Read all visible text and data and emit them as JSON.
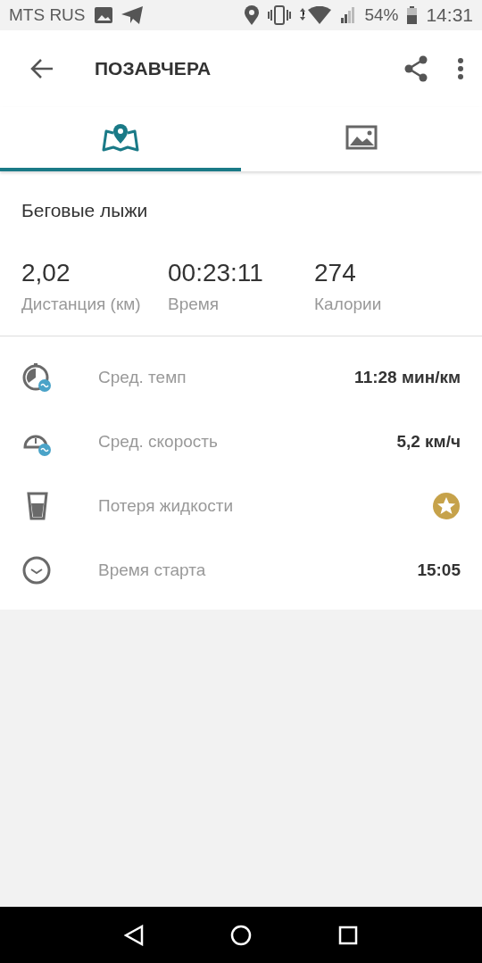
{
  "status_bar": {
    "carrier": "MTS RUS",
    "battery": "54%",
    "time": "14:31"
  },
  "app_bar": {
    "title": "ПОЗАВЧЕРА"
  },
  "tabs": [
    {
      "kind": "map",
      "selected": true
    },
    {
      "kind": "photos",
      "selected": false
    }
  ],
  "activity": "Беговые лыжи",
  "stats": [
    {
      "value": "2,02",
      "label": "Дистанция (км)"
    },
    {
      "value": "00:23:11",
      "label": "Время"
    },
    {
      "value": "274",
      "label": "Калории"
    }
  ],
  "details": [
    {
      "kind": "value",
      "label": "Сред. темп",
      "value": "11:28 мин/км"
    },
    {
      "kind": "value",
      "label": "Сред. скорость",
      "value": "5,2 км/ч"
    },
    {
      "kind": "premium",
      "label": "Потеря жидкости"
    },
    {
      "kind": "value",
      "label": "Время старта",
      "value": "15:05"
    }
  ]
}
